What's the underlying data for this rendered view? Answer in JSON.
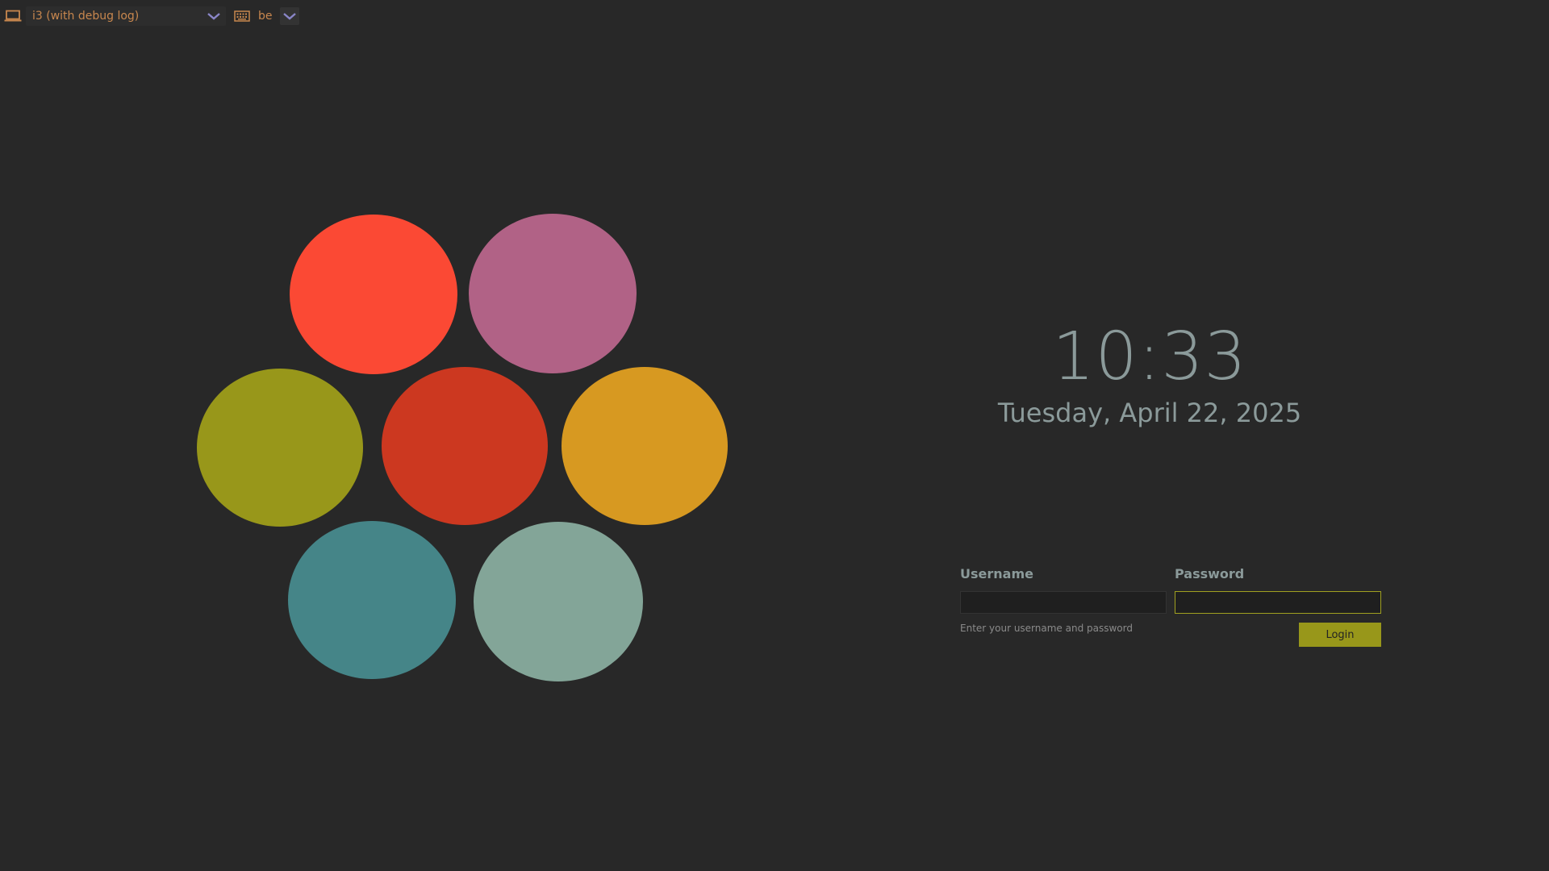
{
  "topbar": {
    "session": {
      "icon": "laptop-icon",
      "selected": "i3 (with debug log)",
      "chevron": "chevron-down-icon"
    },
    "keyboard": {
      "icon": "keyboard-icon",
      "selected": "be",
      "chevron": "chevron-down-icon"
    }
  },
  "logo": {
    "colors": [
      "#fb4934",
      "#b16286",
      "#98971a",
      "#cc3820",
      "#d79921",
      "#458588",
      "#83a598"
    ]
  },
  "clock": {
    "time": "10:33",
    "date": "Tuesday, April 22, 2025"
  },
  "login": {
    "username_label": "Username",
    "password_label": "Password",
    "username_value": "",
    "password_value": "",
    "hint": "Enter your username and password",
    "button_label": "Login"
  },
  "colors": {
    "background": "#282828",
    "accent": "#98971a",
    "text": "#8b9a9a",
    "topbar_text": "#c8874e",
    "chevron": "#8a86c8"
  }
}
